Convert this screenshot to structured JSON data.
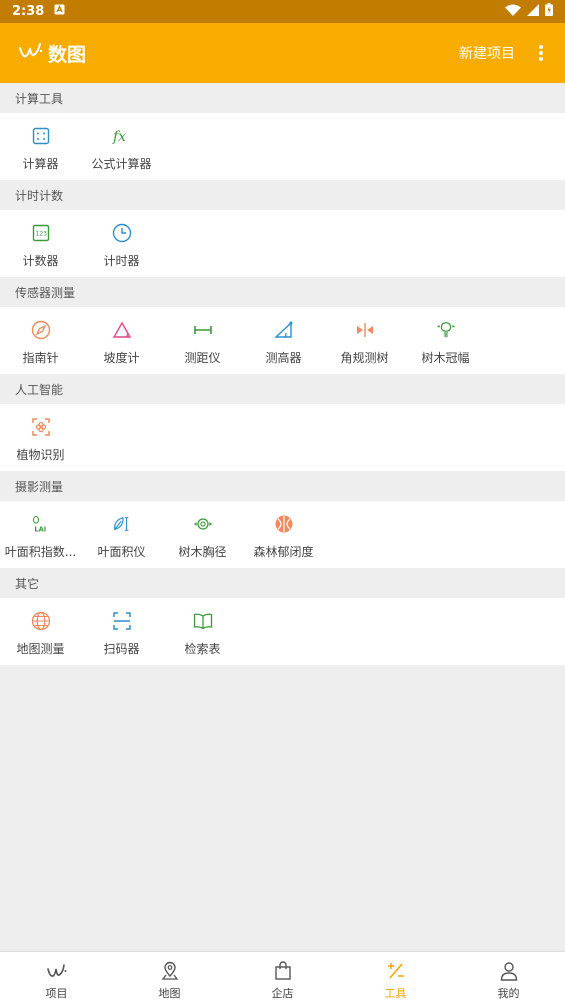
{
  "status_bar": {
    "time": "2:38"
  },
  "app_bar": {
    "title": "数图",
    "new_project": "新建项目"
  },
  "sections": [
    {
      "title": "计算工具",
      "items": [
        {
          "label": "计算器",
          "icon": "calculator-icon"
        },
        {
          "label": "公式计算器",
          "icon": "formula-icon"
        }
      ]
    },
    {
      "title": "计时计数",
      "items": [
        {
          "label": "计数器",
          "icon": "counter-icon"
        },
        {
          "label": "计时器",
          "icon": "clock-icon"
        }
      ]
    },
    {
      "title": "传感器测量",
      "items": [
        {
          "label": "指南针",
          "icon": "compass-icon"
        },
        {
          "label": "坡度计",
          "icon": "slope-icon"
        },
        {
          "label": "测距仪",
          "icon": "range-icon"
        },
        {
          "label": "测高器",
          "icon": "height-icon"
        },
        {
          "label": "角规测树",
          "icon": "angle-gauge-icon"
        },
        {
          "label": "树木冠幅",
          "icon": "crown-width-icon"
        }
      ]
    },
    {
      "title": "人工智能",
      "items": [
        {
          "label": "植物识别",
          "icon": "plant-scan-icon"
        }
      ]
    },
    {
      "title": "摄影测量",
      "items": [
        {
          "label": "叶面积指数...",
          "icon": "lai-icon"
        },
        {
          "label": "叶面积仪",
          "icon": "leaf-area-icon"
        },
        {
          "label": "树木胸径",
          "icon": "tree-dbh-icon"
        },
        {
          "label": "森林郁闭度",
          "icon": "canopy-icon"
        }
      ]
    },
    {
      "title": "其它",
      "items": [
        {
          "label": "地图测量",
          "icon": "globe-icon"
        },
        {
          "label": "扫码器",
          "icon": "scan-icon"
        },
        {
          "label": "检索表",
          "icon": "book-icon"
        }
      ]
    }
  ],
  "bottom_nav": [
    {
      "label": "项目",
      "icon": "project-icon"
    },
    {
      "label": "地图",
      "icon": "map-pin-icon"
    },
    {
      "label": "企店",
      "icon": "shop-bag-icon"
    },
    {
      "label": "工具",
      "icon": "tools-icon",
      "active": true
    },
    {
      "label": "我的",
      "icon": "user-icon"
    }
  ],
  "colors": {
    "status_bar": "#c27d00",
    "app_bar": "#f9ac00",
    "active_tab": "#f5a300",
    "blue": "#2b8fcf",
    "green": "#3a9a3a",
    "pink": "#e0478a",
    "orange": "#f08a5d"
  }
}
